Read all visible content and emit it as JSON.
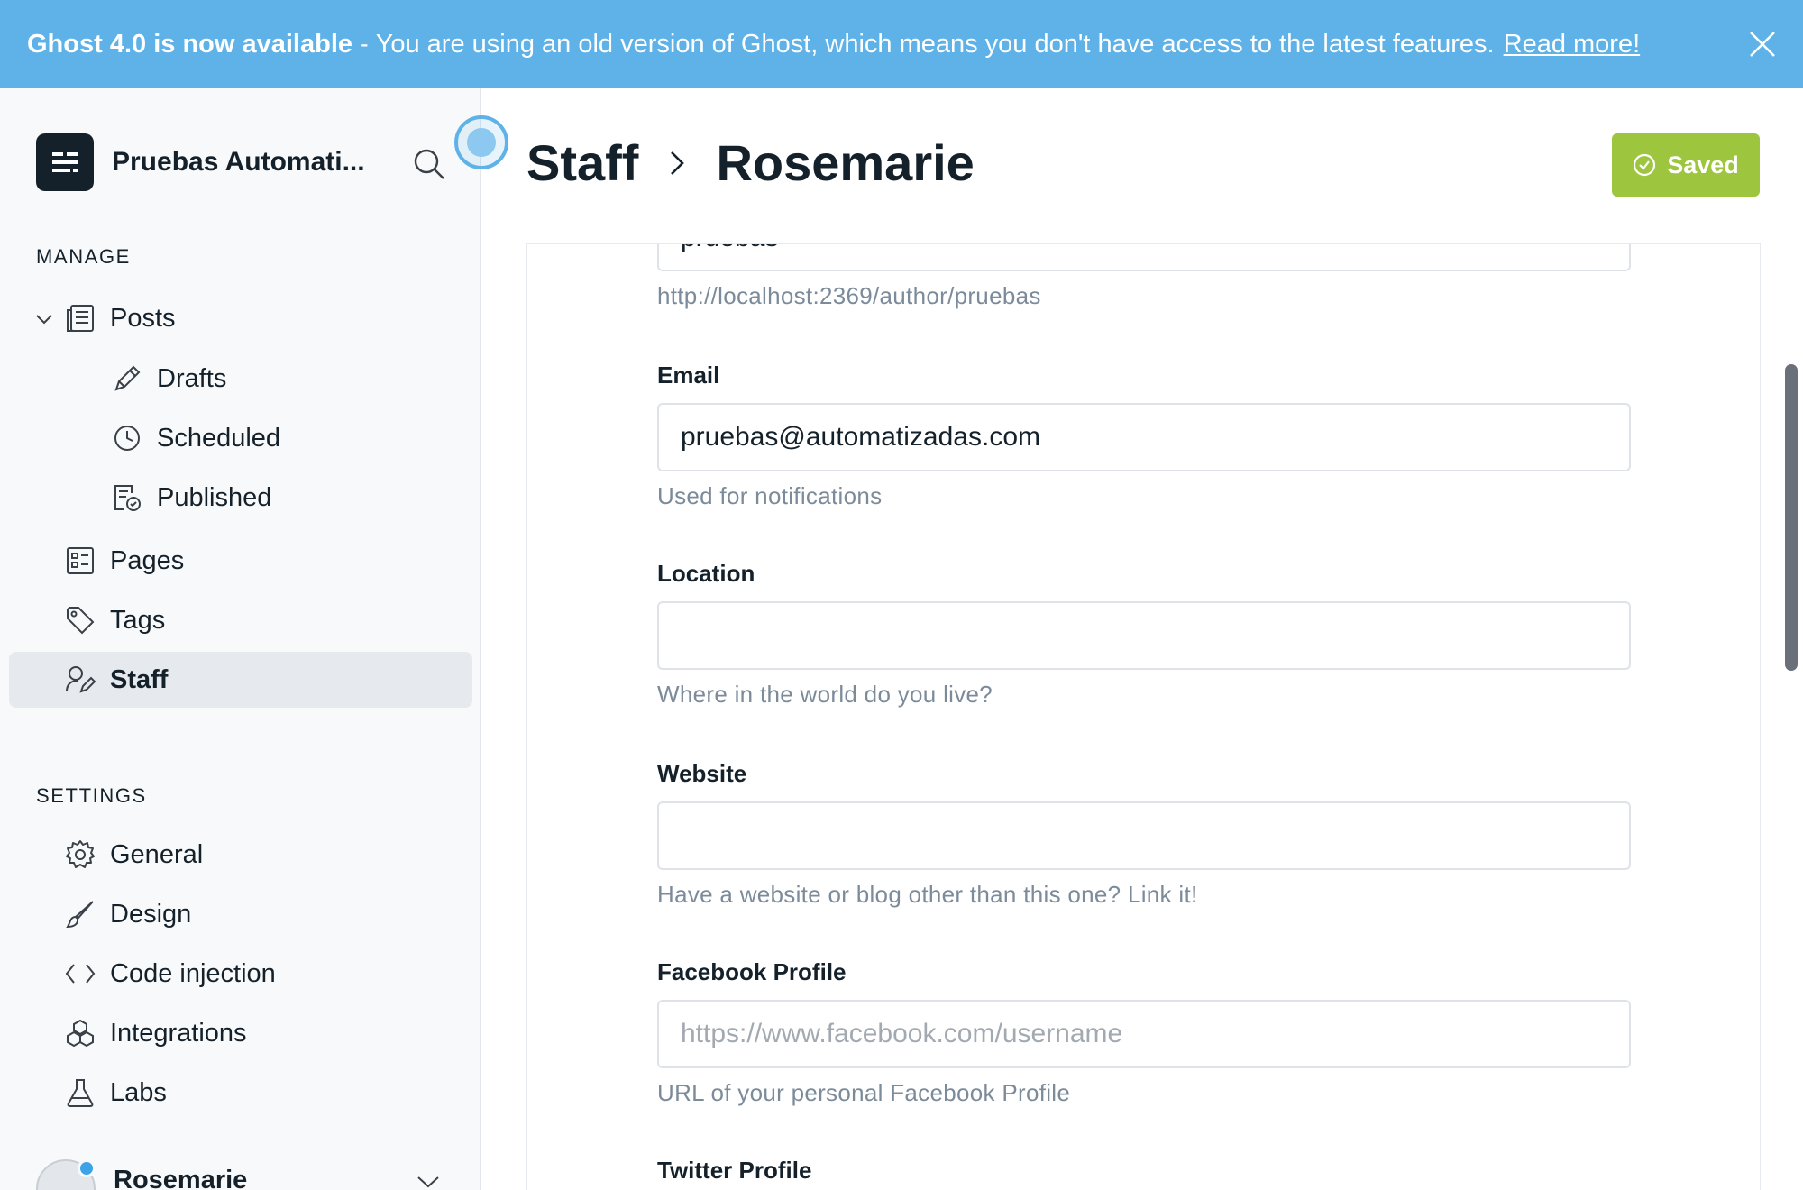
{
  "banner": {
    "strong": "Ghost 4.0 is now available",
    "separator": "-",
    "message": "You are using an old version of Ghost, which means you don't have access to the latest features.",
    "link": "Read more!"
  },
  "sidebar": {
    "site_name": "Pruebas Automati...",
    "manage_label": "MANAGE",
    "settings_label": "SETTINGS",
    "manage_items": [
      {
        "label": "Posts",
        "icon": "posts-icon"
      },
      {
        "label": "Drafts",
        "icon": "pencil-icon"
      },
      {
        "label": "Scheduled",
        "icon": "clock-icon"
      },
      {
        "label": "Published",
        "icon": "published-icon"
      },
      {
        "label": "Pages",
        "icon": "pages-icon"
      },
      {
        "label": "Tags",
        "icon": "tag-icon"
      },
      {
        "label": "Staff",
        "icon": "staff-icon"
      }
    ],
    "settings_items": [
      {
        "label": "General",
        "icon": "gear-icon"
      },
      {
        "label": "Design",
        "icon": "brush-icon"
      },
      {
        "label": "Code injection",
        "icon": "code-icon"
      },
      {
        "label": "Integrations",
        "icon": "integrations-icon"
      },
      {
        "label": "Labs",
        "icon": "flask-icon"
      }
    ],
    "user_name": "Rosemarie"
  },
  "header": {
    "crumb_parent": "Staff",
    "crumb_current": "Rosemarie",
    "saved_label": "Saved"
  },
  "form": {
    "slug_value_partial": "pruebas",
    "slug_help": "http://localhost:2369/author/pruebas",
    "email_label": "Email",
    "email_value": "pruebas@automatizadas.com",
    "email_help": "Used for notifications",
    "location_label": "Location",
    "location_value": "",
    "location_help": "Where in the world do you live?",
    "website_label": "Website",
    "website_value": "",
    "website_help": "Have a website or blog other than this one? Link it!",
    "facebook_label": "Facebook Profile",
    "facebook_placeholder": "https://www.facebook.com/username",
    "facebook_help": "URL of your personal Facebook Profile",
    "twitter_label": "Twitter Profile"
  },
  "colors": {
    "banner": "#5eb2e8",
    "saved": "#9dc53d",
    "active_nav": "#e6e9ee"
  }
}
